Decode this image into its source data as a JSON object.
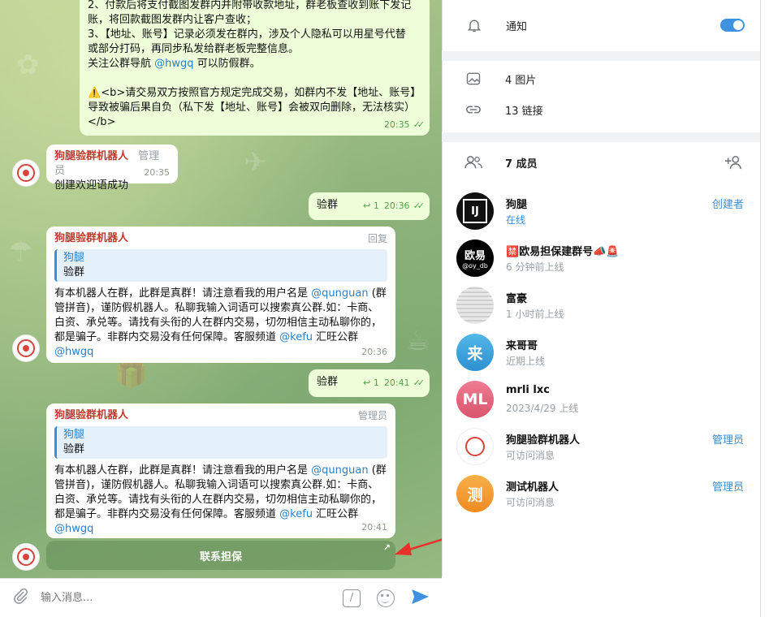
{
  "chat": {
    "top_message": {
      "lines": [
        "2、付款后将支付截图发群内并附带收款地址，群老板查收到账下发记",
        "账，将回款截图发群内让客户查收；",
        "3、【地址、账号】记录必须发在群内，涉及个人隐私可以用星号代替",
        "或部分打码，再同步私发给群老板完整信息。"
      ],
      "follow_prefix": "关注公群导航 ",
      "follow_mention": "@hwgq",
      "follow_suffix": " 可以防假群。",
      "warning_icon": "⚠️",
      "warning_lines": [
        "<b>请交易双方按照官方规定完成交易，如群内不发【地址、账号】",
        "导致被骗后果自负（私下发【地址、账号】会被双向删除，无法核实）",
        "</b>"
      ],
      "time": "20:35"
    },
    "welcome": {
      "sender": "狗腿验群机器人",
      "role": "管理员",
      "text": "创建欢迎语成功",
      "time": "20:35"
    },
    "verify_1": {
      "text": "验群",
      "reply_count": "↩ 1",
      "time": "20:36"
    },
    "bot_reply_1": {
      "sender": "狗腿验群机器人",
      "role": "回复",
      "quote_name": "狗腿",
      "quote_text": "验群",
      "lines": [
        [
          "有本机器人在群，此群是真群！请注意看我的用户名是 ",
          "@qunguan",
          " (群"
        ],
        [
          "管拼音)，谨防假机器人。私聊我输入词语可以搜索真公群.如：卡商、",
          "",
          ""
        ],
        [
          "白资、承兑等。请找有头衔的人在群内交易，切勿相信主动私聊你的，",
          "",
          ""
        ],
        [
          "都是骗子。非群内交易没有任何保障。客服频道 ",
          "@kefu",
          " 汇旺公群"
        ],
        [
          "",
          "@hwgq",
          ""
        ]
      ],
      "time": "20:36"
    },
    "verify_2": {
      "text": "验群",
      "reply_count": "↩ 1",
      "time": "20:41"
    },
    "bot_reply_2": {
      "sender": "狗腿验群机器人",
      "role": "管理员",
      "quote_name": "狗腿",
      "quote_text": "验群",
      "lines": [
        [
          "有本机器人在群，此群是真群！请注意看我的用户名是 ",
          "@qunguan",
          " (群"
        ],
        [
          "管拼音)，谨防假机器人。私聊我输入词语可以搜索真公群.如：卡商、",
          "",
          ""
        ],
        [
          "白资、承兑等。请找有头衔的人在群内交易，切勿相信主动私聊你的，",
          "",
          ""
        ],
        [
          "都是骗子。非群内交易没有任何保障。客服频道 ",
          "@kefu",
          " 汇旺公群"
        ],
        [
          "",
          "@hwgq",
          ""
        ]
      ],
      "time": "20:41"
    },
    "inline_button": {
      "label": "联系担保",
      "arrow": "↗"
    },
    "composer": {
      "placeholder": "输入消息...",
      "command_glyph": "/"
    }
  },
  "panel": {
    "notifications": {
      "label": "通知",
      "enabled": true
    },
    "media": [
      {
        "icon": "image-icon",
        "label": "4 图片"
      },
      {
        "icon": "link-icon",
        "label": "13 链接"
      }
    ],
    "members_header": {
      "label": "7 成员"
    },
    "members": [
      {
        "avatar_text": "IJ",
        "avatar_color": "#111111",
        "name": "狗腿",
        "status": "在线",
        "online": true,
        "role": "创建者"
      },
      {
        "avatar_text": "欧易",
        "avatar_sub": "@oy_db",
        "avatar_color": "#000000",
        "name": "欧易担保建群号",
        "name_prefix": "🈲",
        "name_suffix": "📣🚨",
        "status": "6 分钟前上线",
        "online": false,
        "role": ""
      },
      {
        "avatar_text": "",
        "avatar_color": "#dcdcdc",
        "name": "富豪",
        "status": "1 小时前上线",
        "online": false,
        "role": ""
      },
      {
        "avatar_text": "来",
        "avatar_color": "#3aa0d8",
        "name": "来哥哥",
        "status": "近期上线",
        "online": false,
        "role": ""
      },
      {
        "avatar_text": "ML",
        "avatar_color": "#e0637a",
        "name": "mrli lxc",
        "status": "2023/4/29 上线",
        "online": false,
        "role": ""
      },
      {
        "avatar_text": "",
        "avatar_color": "#ffffff",
        "name": "狗腿验群机器人",
        "status": "可访问消息",
        "online": false,
        "role": "管理员"
      },
      {
        "avatar_text": "测",
        "avatar_color": "#f29a2e",
        "name": "测试机器人",
        "status": "可访问消息",
        "online": false,
        "role": "管理员"
      }
    ]
  },
  "colors": {
    "accent": "#3e92e0",
    "sender_red": "#c0392b",
    "out_bubble": "#eefed9",
    "check_green": "#4fa74a"
  }
}
